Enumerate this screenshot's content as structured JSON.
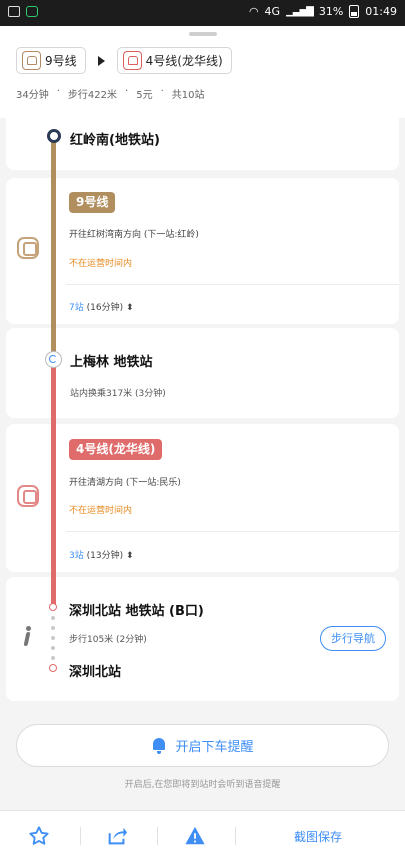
{
  "status": {
    "network": "4G",
    "battery": "31%",
    "time": "01:49"
  },
  "route": {
    "from_line": "9号线",
    "to_line": "4号线(龙华线)",
    "duration": "34分钟",
    "walk": "步行422米",
    "fare": "5元",
    "stops_total": "共10站"
  },
  "segments": {
    "start_station": "红岭南(地铁站)",
    "line1": {
      "badge": "9号线",
      "direction": "开往红树湾南方向 (下一站:红岭)",
      "status": "不在运营时间内",
      "stops_num": "7站",
      "stops_time": "(16分钟)"
    },
    "transfer_station": "上梅林 地铁站",
    "transfer_info": "站内换乘317米 (3分钟)",
    "line2": {
      "badge": "4号线(龙华线)",
      "direction": "开往清湖方向 (下一站:民乐)",
      "status": "不在运营时间内",
      "stops_num": "3站",
      "stops_time": "(13分钟)"
    },
    "exit_station": "深圳北站 地铁站 (B口)",
    "walk_info": "步行105米 (2分钟)",
    "walk_nav_label": "步行导航",
    "end_station": "深圳北站"
  },
  "reminder": {
    "button_label": "开启下车提醒",
    "tip": "开启后,在您即将到站时会听到语音提醒"
  },
  "bottom": {
    "save_label": "截图保存"
  },
  "colors": {
    "line9": "#b08e5d",
    "line4": "#e06b6b",
    "accent": "#3e8ef5",
    "warning": "#e58a1f"
  }
}
